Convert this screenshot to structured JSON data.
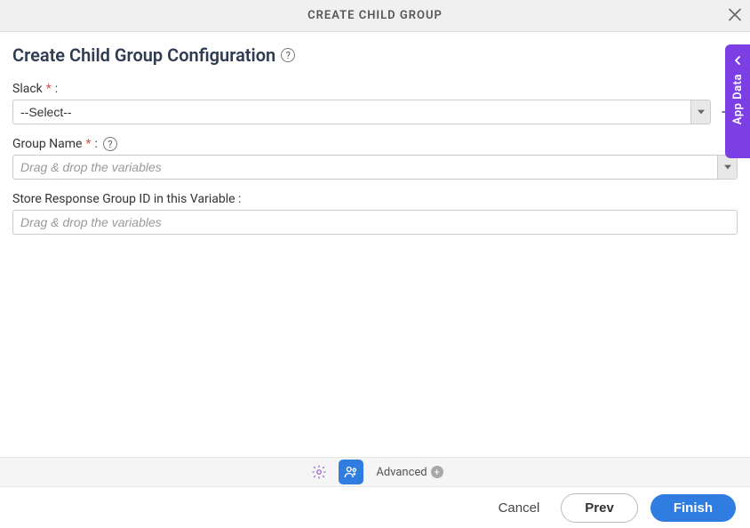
{
  "titlebar": {
    "title": "CREATE CHILD GROUP"
  },
  "page": {
    "title": "Create Child Group Configuration"
  },
  "fields": {
    "slack": {
      "label": "Slack",
      "value": "--Select--",
      "required": true
    },
    "groupName": {
      "label": "Group Name",
      "placeholder": "Drag & drop the variables",
      "required": true
    },
    "storeVar": {
      "label": "Store Response Group ID in this Variable :",
      "placeholder": "Drag & drop the variables"
    }
  },
  "tabbar": {
    "advanced": "Advanced"
  },
  "footer": {
    "cancel": "Cancel",
    "prev": "Prev",
    "finish": "Finish"
  },
  "sidePanel": {
    "label": "App Data"
  },
  "colors": {
    "accent": "#2f7de1",
    "sidePanel": "#7b3fe4",
    "required": "#d9534f"
  }
}
